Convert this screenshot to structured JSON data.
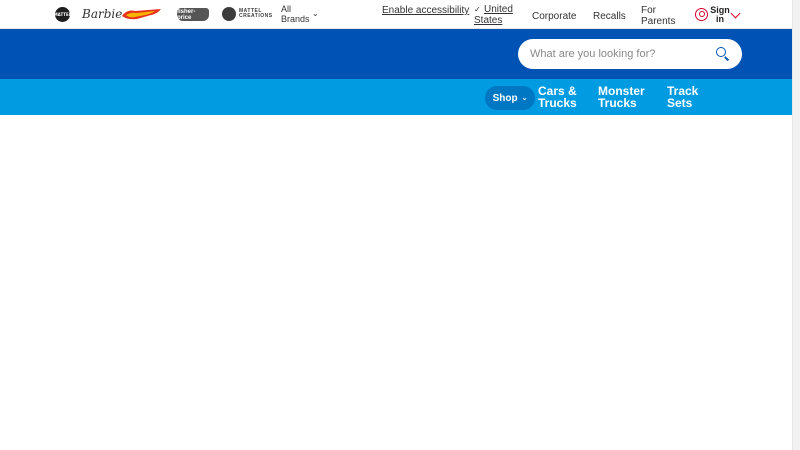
{
  "topbar": {
    "brands": {
      "mattel_text": "MATTEL",
      "barbie_text": "Barbie",
      "fisherprice_text": "fisher-price",
      "creations_line1": "MATTEL",
      "creations_line2": "CREATIONS"
    },
    "all_brands_label": "All Brands",
    "enable_accessibility": "Enable accessibility",
    "country_label": "United States",
    "corporate": "Corporate",
    "recalls": "Recalls",
    "for_parents": "For Parents",
    "sign_in": "Sign in"
  },
  "header": {
    "search_placeholder": "What are you looking for?"
  },
  "nav": {
    "shop_label": "Shop",
    "items": [
      {
        "label": "Cars & Trucks"
      },
      {
        "label": "Monster Trucks"
      },
      {
        "label": "Track Sets"
      }
    ]
  },
  "colors": {
    "header_blue": "#0052b4",
    "nav_blue": "#009be0",
    "shop_pill": "#0077c2",
    "accent_red": "#d9002b"
  }
}
